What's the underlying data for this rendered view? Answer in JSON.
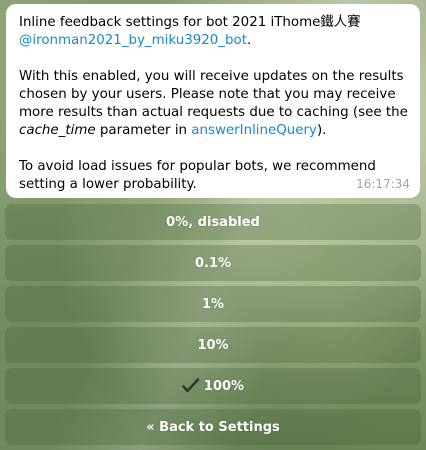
{
  "message": {
    "p1_text": "Inline feedback settings for bot 2021 iThome鐵人賽 ",
    "p1_link": "@ironman2021_by_miku3920_bot",
    "p1_end": ".",
    "p2_a": "With this enabled, you will receive updates on the results chosen by your users. Please note that you may receive more results than actual requests due to caching (see the ",
    "p2_italic": "cache_time",
    "p2_b": " parameter in ",
    "p2_link": "answerInlineQuery",
    "p2_c": ").",
    "p3": "To avoid load issues for popular bots, we recommend setting a lower probability.",
    "time": "16:17:34"
  },
  "keyboard": {
    "buttons": [
      {
        "label": "0%, disabled"
      },
      {
        "label": "0.1%"
      },
      {
        "label": "1%"
      },
      {
        "label": "10%"
      },
      {
        "label": "100%",
        "checked": true
      },
      {
        "label": "« Back to Settings"
      }
    ]
  },
  "icons": {
    "selected_check": "check-icon"
  },
  "colors": {
    "link": "#168acd",
    "bubble": "#ffffff",
    "time": "#9aa5ad"
  }
}
